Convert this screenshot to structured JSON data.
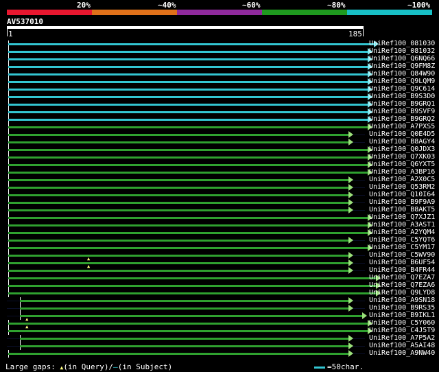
{
  "header": {
    "percent_labels": [
      "20%",
      "~40%",
      "~60%",
      "~80%",
      "~100%"
    ],
    "scale_colors": [
      "#e8172f",
      "#e0711a",
      "#8f2a9c",
      "#1f9a1f",
      "#18c0c6"
    ]
  },
  "query": {
    "name": "AV537010",
    "start": "1",
    "end": "185",
    "length": 185
  },
  "colors": {
    "cyan": "#33c6d2",
    "green": "#2fa12f",
    "arrow_green": "#9be07a",
    "arrow_cyan": "#7fe8f0"
  },
  "hits": [
    {
      "label": "UniRef100_081030",
      "color": "cyan",
      "start": 1,
      "end": 191,
      "gap": null
    },
    {
      "label": "UniRef100_081032",
      "color": "cyan",
      "start": 1,
      "end": 188,
      "gap": null
    },
    {
      "label": "UniRef100_Q6NQ66",
      "color": "cyan",
      "start": 1,
      "end": 188,
      "gap": null
    },
    {
      "label": "UniRef100_Q9FM8Z",
      "color": "cyan",
      "start": 1,
      "end": 188,
      "gap": null
    },
    {
      "label": "UniRef100_Q84W90",
      "color": "cyan",
      "start": 1,
      "end": 188,
      "gap": null
    },
    {
      "label": "UniRef100_Q9LQM9",
      "color": "cyan",
      "start": 1,
      "end": 188,
      "gap": null
    },
    {
      "label": "UniRef100_Q9C614",
      "color": "cyan",
      "start": 1,
      "end": 188,
      "gap": null
    },
    {
      "label": "UniRef100_B9S3D0",
      "color": "cyan",
      "start": 1,
      "end": 188,
      "gap": null
    },
    {
      "label": "UniRef100_B9GRQ1",
      "color": "cyan",
      "start": 1,
      "end": 188,
      "gap": null
    },
    {
      "label": "UniRef100_B9SVF9",
      "color": "cyan",
      "start": 1,
      "end": 188,
      "gap": null
    },
    {
      "label": "UniRef100_B9GRQ2",
      "color": "cyan",
      "start": 1,
      "end": 188,
      "gap": null
    },
    {
      "label": "UniRef100_A7PXS5",
      "color": "green",
      "start": 1,
      "end": 188,
      "gap": null
    },
    {
      "label": "UniRef100_Q0E4D5",
      "color": "green",
      "start": 1,
      "end": 178,
      "gap": null
    },
    {
      "label": "UniRef100_B8AGY4",
      "color": "green",
      "start": 1,
      "end": 178,
      "gap": null
    },
    {
      "label": "UniRef100_Q0JDX3",
      "color": "green",
      "start": 1,
      "end": 188,
      "gap": null
    },
    {
      "label": "UniRef100_Q7XK03",
      "color": "green",
      "start": 1,
      "end": 188,
      "gap": null
    },
    {
      "label": "UniRef100_Q6YXT5",
      "color": "green",
      "start": 1,
      "end": 188,
      "gap": null
    },
    {
      "label": "UniRef100_A3BP16",
      "color": "green",
      "start": 1,
      "end": 188,
      "gap": null
    },
    {
      "label": "UniRef100_A2X0C5",
      "color": "green",
      "start": 1,
      "end": 178,
      "gap": null
    },
    {
      "label": "UniRef100_Q53RM2",
      "color": "green",
      "start": 1,
      "end": 178,
      "gap": null
    },
    {
      "label": "UniRef100_Q10I64",
      "color": "green",
      "start": 1,
      "end": 178,
      "gap": null
    },
    {
      "label": "UniRef100_B9F9A9",
      "color": "green",
      "start": 1,
      "end": 178,
      "gap": null
    },
    {
      "label": "UniRef100_B8AKT5",
      "color": "green",
      "start": 1,
      "end": 178,
      "gap": null
    },
    {
      "label": "UniRef100_Q7XJZ1",
      "color": "green",
      "start": 1,
      "end": 188,
      "gap": null
    },
    {
      "label": "UniRef100_A3AST1",
      "color": "green",
      "start": 1,
      "end": 188,
      "gap": null
    },
    {
      "label": "UniRef100_A2YQM4",
      "color": "green",
      "start": 1,
      "end": 188,
      "gap": null
    },
    {
      "label": "UniRef100_C5YQT6",
      "color": "green",
      "start": 1,
      "end": 178,
      "gap": null
    },
    {
      "label": "UniRef100_C5YM17",
      "color": "green",
      "start": 1,
      "end": 188,
      "gap": null
    },
    {
      "label": "UniRef100_C5WV90",
      "color": "green",
      "start": 1,
      "end": 178,
      "gap": null
    },
    {
      "label": "UniRef100_B6UF54",
      "color": "green",
      "start": 1,
      "end": 178,
      "gap": 43
    },
    {
      "label": "UniRef100_B4FR44",
      "color": "green",
      "start": 1,
      "end": 178,
      "gap": 43
    },
    {
      "label": "UniRef100_Q7EZA7",
      "color": "green",
      "start": 1,
      "end": 192,
      "gap": null
    },
    {
      "label": "UniRef100_Q7EZA6",
      "color": "green",
      "start": 1,
      "end": 192,
      "gap": null
    },
    {
      "label": "UniRef100_Q9LYD8",
      "color": "green",
      "start": 1,
      "end": 192,
      "gap": null
    },
    {
      "label": "UniRef100_A9SN18",
      "color": "green",
      "start": 7,
      "end": 178,
      "gap": null
    },
    {
      "label": "UniRef100_B9RS35",
      "color": "green",
      "start": 7,
      "end": 178,
      "gap": null
    },
    {
      "label": "UniRef100_B9IKL1",
      "color": "green",
      "start": 7,
      "end": 185,
      "gap": null
    },
    {
      "label": "UniRef100_C5Y060",
      "color": "green",
      "start": 1,
      "end": 188,
      "gap": 11
    },
    {
      "label": "UniRef100_C4J5T9",
      "color": "green",
      "start": 1,
      "end": 188,
      "gap": 11
    },
    {
      "label": "UniRef100_A7P5A2",
      "color": "green",
      "start": 7,
      "end": 178,
      "gap": null
    },
    {
      "label": "UniRef100_A5AI48",
      "color": "green",
      "start": 7,
      "end": 178,
      "gap": null
    },
    {
      "label": "UniRef100_A9NW40",
      "color": "green",
      "start": 1,
      "end": 178,
      "gap": null
    }
  ],
  "footer": {
    "legend_prefix": "Large gaps:",
    "in_query": "(in Query)/",
    "in_subject": "(in Subject)",
    "dash": "–",
    "triangle": "▲",
    "scale_key": "=50char."
  }
}
